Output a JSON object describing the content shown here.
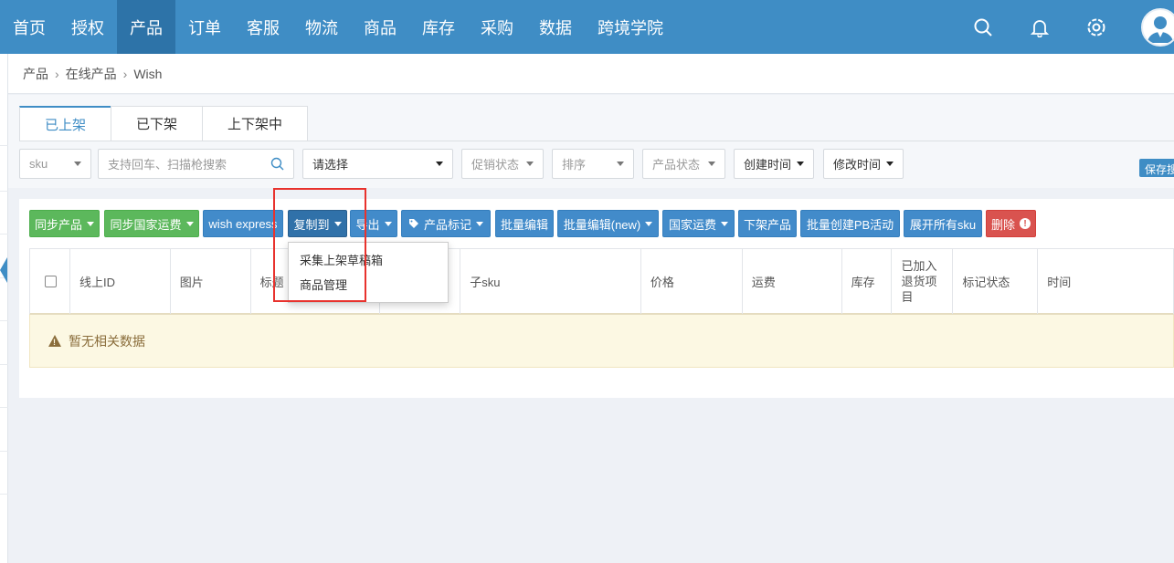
{
  "nav": {
    "items": [
      "首页",
      "授权",
      "产品",
      "订单",
      "客服",
      "物流",
      "商品",
      "库存",
      "采购",
      "数据",
      "跨境学院"
    ],
    "active_index": 2
  },
  "breadcrumb": [
    "产品",
    "在线产品",
    "Wish"
  ],
  "tabs": [
    "已上架",
    "已下架",
    "上下架中"
  ],
  "filters": {
    "sku": "sku",
    "search_placeholder": "支持回车、扫描枪搜索",
    "select": "请选择",
    "promo": "促销状态",
    "sort": "排序",
    "status": "产品状态",
    "created": "创建时间",
    "modified": "修改时间",
    "save": "保存搜"
  },
  "toolbar": {
    "sync_product": "同步产品",
    "sync_shipping": "同步国家运费",
    "wish_express": "wish express",
    "copy_to": "复制到",
    "export": "导出",
    "tag": "产品标记",
    "batch_edit": "批量编辑",
    "batch_edit_new": "批量编辑(new)",
    "country_shipping": "国家运费",
    "delist": "下架产品",
    "create_pb": "批量创建PB活动",
    "expand_sku": "展开所有sku",
    "delete": "删除"
  },
  "dropdown": [
    "采集上架草稿箱",
    "商品管理"
  ],
  "table": {
    "headers": [
      "线上ID",
      "图片",
      "标题",
      "",
      "子sku",
      "价格",
      "运费",
      "库存",
      "已加入退货项目",
      "标记状态",
      "时间"
    ],
    "empty_text": "暂无相关数据"
  },
  "colors": {
    "nav_bg": "#3f8dc5",
    "primary": "#428bca",
    "success": "#5cb85c",
    "danger": "#d9534f",
    "highlight": "#e8322d"
  }
}
